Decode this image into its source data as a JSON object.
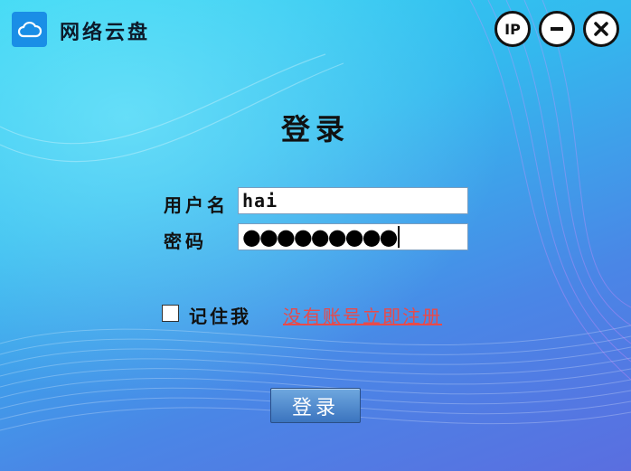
{
  "header": {
    "app_title": "网络云盘",
    "logo_icon": "cloud-icon",
    "window_buttons": {
      "ip_label": "IP",
      "minimize_icon": "minus-circle-icon",
      "close_icon": "close-circle-icon"
    }
  },
  "form": {
    "heading": "登录",
    "username_label": "用户名",
    "username_value": "hai",
    "password_label": "密码",
    "password_masked": "●●●●●●●●●",
    "remember_label": "记住我",
    "remember_checked": false,
    "register_link": "没有账号立即注册",
    "login_button": "登录"
  },
  "colors": {
    "link": "#e84a4a",
    "button": "#3b74bf",
    "logo_bg": "#1a8ee6"
  }
}
